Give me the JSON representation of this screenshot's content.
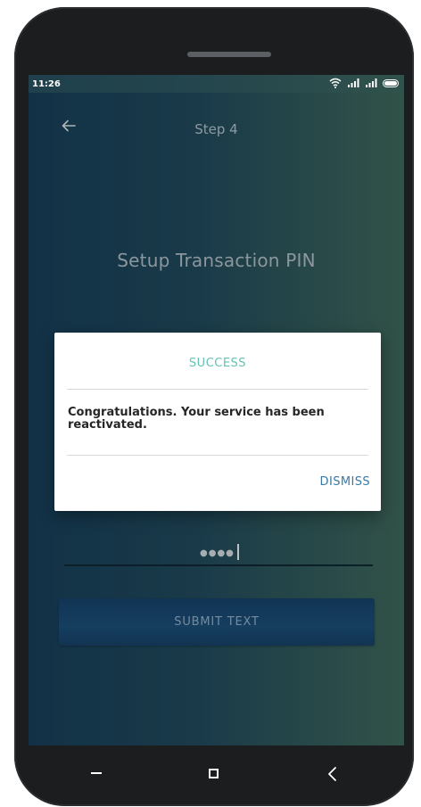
{
  "status_bar": {
    "time": "11:26"
  },
  "header": {
    "step_title": "Step 4"
  },
  "page": {
    "title": "Setup Transaction PIN"
  },
  "pin_field": {
    "masked_value": "●●●●"
  },
  "submit_button": {
    "label": "SUBMIT TEXT"
  },
  "dialog": {
    "title": "SUCCESS",
    "message": "Congratulations. Your service has been reactivated.",
    "dismiss_label": "DISMISS"
  },
  "colors": {
    "dialog_title": "#66c2b3",
    "dismiss": "#3a79a5",
    "submit_bg": "#1a4a72",
    "screen_gradient_start": "#163b55",
    "screen_gradient_end": "#3b6256"
  },
  "icons": {
    "back": "left-arrow-icon",
    "wifi": "wifi-icon",
    "signal": "signal-icon",
    "battery": "battery-icon"
  }
}
